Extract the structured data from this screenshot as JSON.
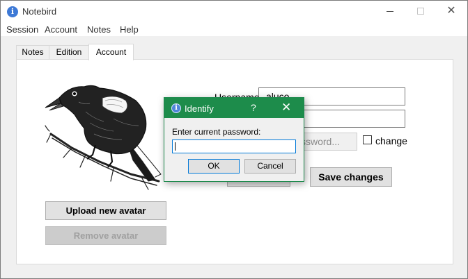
{
  "window": {
    "title": "Notebird",
    "minimize_symbol": "",
    "maximize_symbol": "",
    "close_symbol": "✕"
  },
  "menu": [
    "Session",
    "Account",
    "Notes",
    "Help"
  ],
  "tabs": [
    {
      "label": "Notes",
      "active": false
    },
    {
      "label": "Edition",
      "active": false
    },
    {
      "label": "Account",
      "active": true
    }
  ],
  "account": {
    "username_label": "Username:",
    "username_value": "aluco",
    "email_value": "",
    "password_value": "Password...",
    "change_label": "change",
    "change_checked": false,
    "upload_avatar": "Upload new avatar",
    "remove_avatar": "Remove avatar",
    "save_changes": "Save changes"
  },
  "dialog": {
    "title": "Identify",
    "help_symbol": "?",
    "close_symbol": "✕",
    "prompt": "Enter current password:",
    "password_value": "",
    "ok_label": "OK",
    "cancel_label": "Cancel",
    "accent_color": "#1d8c4b"
  },
  "icons": {
    "app": "info-icon",
    "avatar": "crow-illustration"
  }
}
